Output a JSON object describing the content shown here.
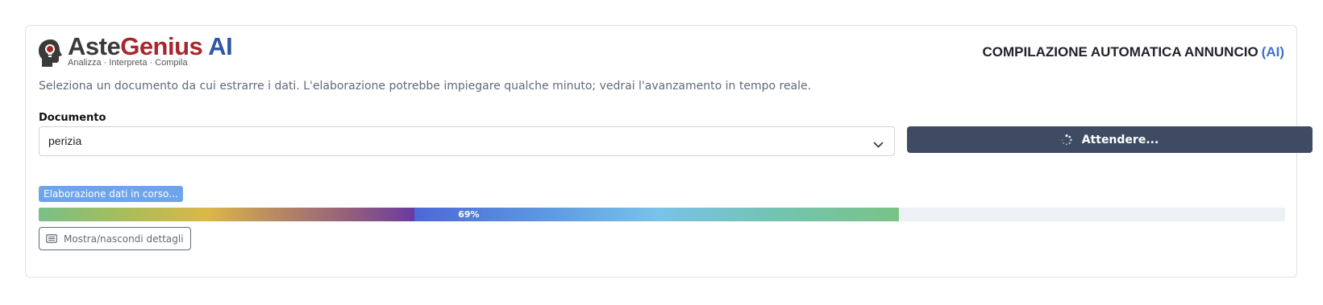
{
  "brand": {
    "name_part1": "Aste",
    "name_part2": "Genius",
    "name_part3": "AI",
    "tagline": "Analizza · Interpreta · Compila"
  },
  "header": {
    "title": "COMPILAZIONE AUTOMATICA ANNUNCIO",
    "title_suffix": "(AI)"
  },
  "intro_text": "Seleziona un documento da cui estrarre i dati. L'elaborazione potrebbe impiegare qualche minuto; vedrai l'avanzamento in tempo reale.",
  "document_field": {
    "label": "Documento",
    "selected_value": "perizia"
  },
  "action_button": {
    "label": "Attendere...",
    "icon": "spinner-icon"
  },
  "progress": {
    "status_label": "Elaborazione dati in corso...",
    "value_label": "69%",
    "fraction": 0.69
  },
  "details_button": {
    "label": "Mostra/nascondi dettagli",
    "icon": "list-icon"
  },
  "colors": {
    "brand_dark": "#3a3a3a",
    "brand_red": "#a8262c",
    "brand_blue": "#2f55a4",
    "button_bg": "#3e4b62",
    "badge_bg": "#6ea4ec",
    "track_bg": "#edf1f5"
  }
}
